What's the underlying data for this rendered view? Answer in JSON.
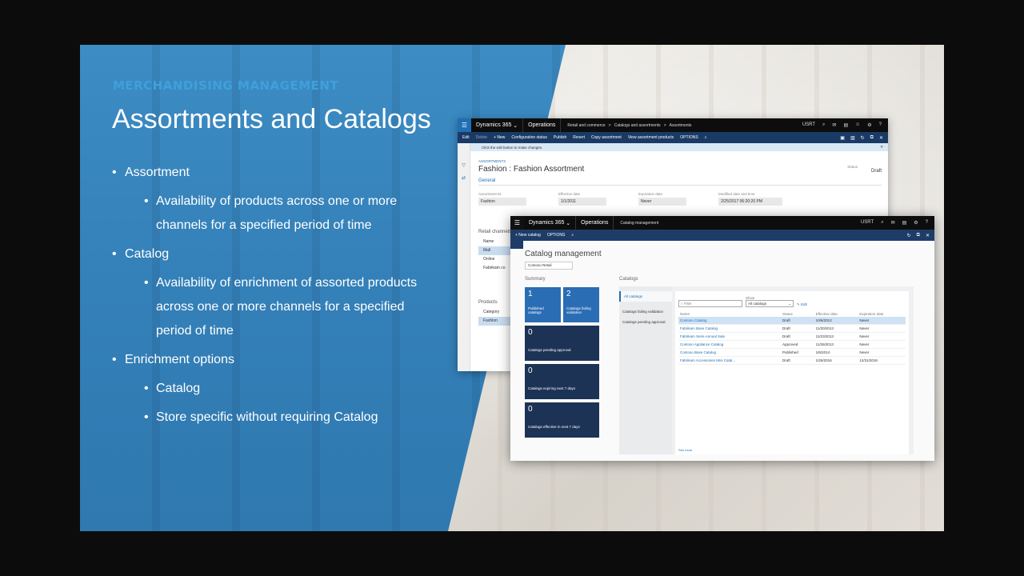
{
  "slide": {
    "eyebrow": "MERCHANDISING MANAGEMENT",
    "title": "Assortments and Catalogs",
    "bullets": [
      {
        "text": "Assortment",
        "sub": [
          "Availability of products across one or more channels  for a specified period of time"
        ]
      },
      {
        "text": "Catalog",
        "sub": [
          "Availability of enrichment of assorted products across one or more channels for a specified period of time"
        ]
      },
      {
        "text": "Enrichment options",
        "sub": [
          "Catalog",
          "Store specific without requiring Catalog"
        ]
      }
    ]
  },
  "assortment_window": {
    "brand": "Dynamics 365",
    "app": "Operations",
    "crumbs": [
      "Retail and commerce",
      ">",
      "Catalogs and assortments",
      ">",
      "Assortments"
    ],
    "user": "USRT",
    "actions": [
      "Edit",
      "Delete",
      "+ New",
      "Configuration status",
      "Publish",
      "Revert",
      "Copy assortment",
      "View assortment products",
      "OPTIONS"
    ],
    "message": "Click the edit button to make changes.",
    "section_label": "ASSORTMENTS",
    "record_title": "Fashion : Fashion Assortment",
    "status_label": "Status",
    "status_value": "Draft",
    "general": "General",
    "fields": [
      {
        "label": "Assortment ID",
        "value": "Fashion"
      },
      {
        "label": "Effective date",
        "value": "1/1/2011"
      },
      {
        "label": "Expiration date",
        "value": "Never"
      },
      {
        "label": "Modified date and time",
        "value": "2/25/2017 06:20:20 PM"
      }
    ],
    "retail_channels": "Retail channels",
    "channel_items": [
      "Name",
      "Mall",
      "Online",
      "Fabrikam co"
    ],
    "products": "Products",
    "product_items": [
      "Category",
      "Fashion"
    ]
  },
  "catalog_window": {
    "brand": "Dynamics 365",
    "app": "Operations",
    "crumb": "Catalog management",
    "user": "USRT",
    "actions": [
      "+ New catalog",
      "OPTIONS"
    ],
    "page_title": "Catalog management",
    "company": "Contoso Retail",
    "summary_label": "Summary",
    "catalogs_label": "Catalogs",
    "tiles": [
      {
        "num": "1",
        "label": "Published catalogs"
      },
      {
        "num": "2",
        "label": "Catalogs failing validation"
      },
      {
        "num": "0",
        "label": "Catalogs pending approval"
      },
      {
        "num": "0",
        "label": "Catalogs expiring next 7 days"
      },
      {
        "num": "0",
        "label": "Catalogs effective in next 7 days"
      }
    ],
    "nav": [
      "All catalogs",
      "Catalogs failing validation",
      "Catalogs pending approval"
    ],
    "filter_placeholder": "Filter",
    "show_label": "Show",
    "show_value": "All catalogs",
    "edit_label": "Edit",
    "columns": [
      "Name",
      "Status",
      "Effective date",
      "Expiration date"
    ],
    "rows": [
      [
        "Contoso Catalog",
        "Draft",
        "10/6/2012",
        "Never"
      ],
      [
        "Fabrikam Base Catalog",
        "Draft",
        "11/20/2013",
        "Never"
      ],
      [
        "Fabrikam Semi-Annual Sale",
        "Draft",
        "11/23/2013",
        "Never"
      ],
      [
        "Contoso Appliance Catalog",
        "Approved",
        "11/26/2013",
        "Never"
      ],
      [
        "Contoso Base Catalog",
        "Published",
        "1/6/2014",
        "Never"
      ],
      [
        "Fabrikam Accessories Mini Catal...",
        "Draft",
        "1/26/2016",
        "12/31/2016"
      ]
    ],
    "see_more": "See more"
  }
}
